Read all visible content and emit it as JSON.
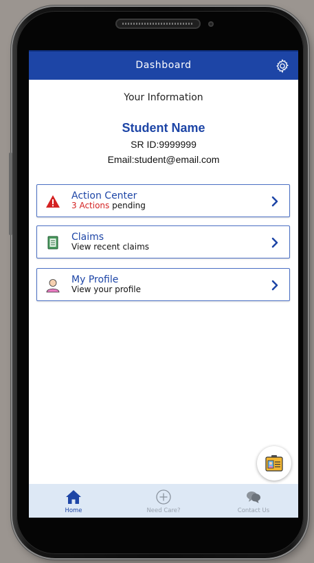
{
  "header": {
    "title": "Dashboard",
    "settings_icon": "gear-icon"
  },
  "profile": {
    "section_title": "Your Information",
    "name": "Student Name",
    "sr_label": "SR ID:",
    "sr_value": "9999999",
    "email_label": "Email:",
    "email_value": "student@email.com"
  },
  "cards": [
    {
      "title": "Action Center",
      "subtitle_highlight": "3 Actions",
      "subtitle_rest": " pending",
      "icon": "warning-icon"
    },
    {
      "title": "Claims",
      "subtitle": "View recent claims",
      "icon": "document-icon"
    },
    {
      "title": "My Profile",
      "subtitle": "View your profile",
      "icon": "user-icon"
    }
  ],
  "fab": {
    "icon": "id-card-icon"
  },
  "nav": [
    {
      "label": "Home",
      "icon": "home-icon",
      "active": true
    },
    {
      "label": "Need Care?",
      "icon": "plus-circle-icon",
      "active": false
    },
    {
      "label": "Contact Us",
      "icon": "chat-bubble-icon",
      "active": false
    }
  ],
  "colors": {
    "brand_blue": "#1d45a6",
    "alert_red": "#d42222",
    "nav_background": "#dde8f5",
    "device_background": "#9b9590"
  }
}
